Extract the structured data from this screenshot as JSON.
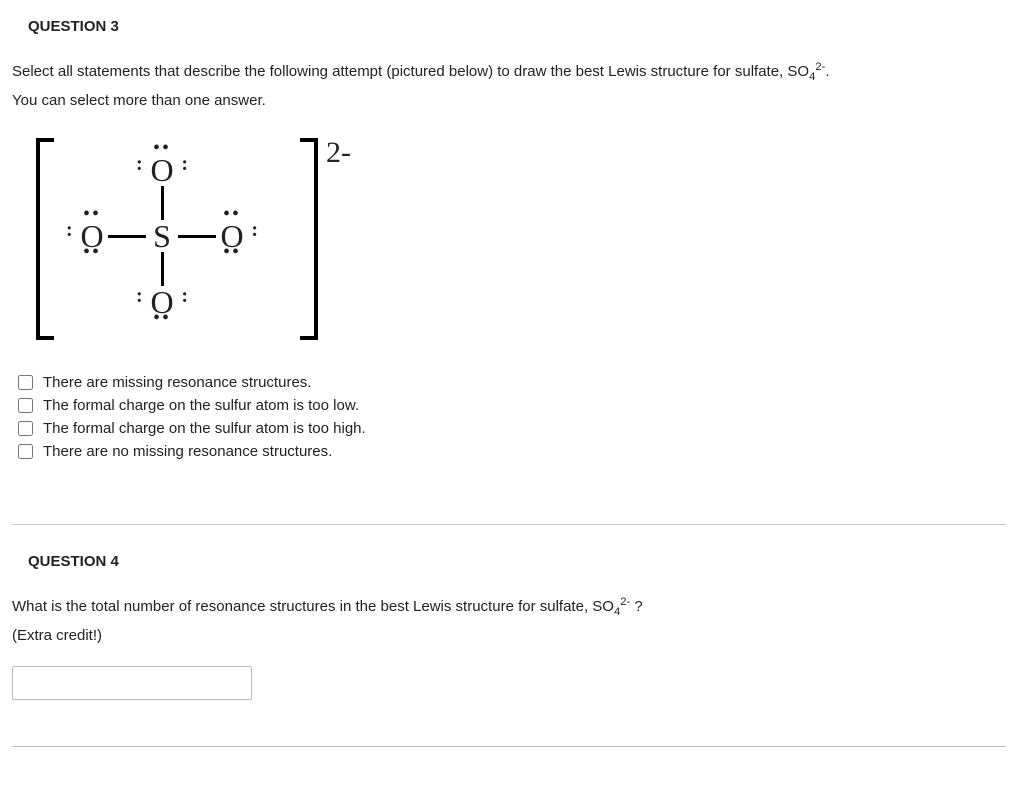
{
  "q3": {
    "heading": "QUESTION 3",
    "prompt_part1": "Select all statements that describe the following attempt (pictured below) to draw the best Lewis structure for sulfate, SO",
    "prompt_sub": "4",
    "prompt_sup": "2-",
    "prompt_part2": ".",
    "prompt_line2": "You can select more than one answer.",
    "lewis": {
      "top_atom": "O",
      "left_atom": "O",
      "center_atom": "S",
      "right_atom": "O",
      "bottom_atom": "O",
      "charge": "2-"
    },
    "options": [
      "There are missing resonance structures.",
      "The formal charge on the sulfur atom is too low.",
      "The formal charge on the sulfur atom is too high.",
      "There are no missing resonance structures."
    ]
  },
  "q4": {
    "heading": "QUESTION 4",
    "prompt_part1": "What is the total number of resonance structures in the best Lewis structure for sulfate, SO",
    "prompt_sub": "4",
    "prompt_sup": "2-",
    "prompt_part2": " ?",
    "prompt_line2": "(Extra credit!)",
    "answer_value": ""
  }
}
